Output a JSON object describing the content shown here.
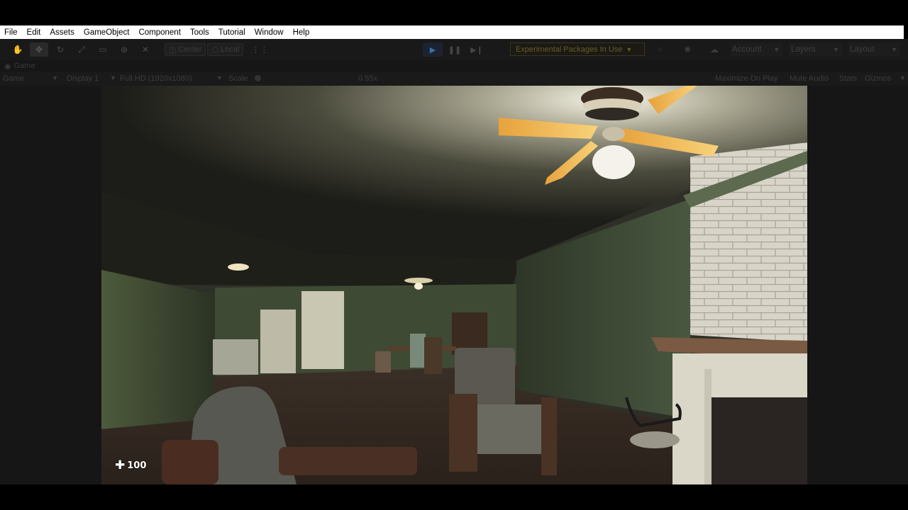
{
  "menubar": {
    "items": [
      "File",
      "Edit",
      "Assets",
      "GameObject",
      "Component",
      "Tools",
      "Tutorial",
      "Window",
      "Help"
    ]
  },
  "toolbar": {
    "pivot_label": "Center",
    "space_label": "Local",
    "experimental_label": "Experimental Packages In Use",
    "account_label": "Account",
    "layers_label": "Layers",
    "layout_label": "Layout",
    "play_state": "playing"
  },
  "game_view": {
    "tab_label": "Game",
    "mode_label": "Game",
    "display_label": "Display 1",
    "resolution_label": "Full HD (1920x1080)",
    "scale_label": "Scale",
    "scale_value": "0.55x",
    "maximize_label": "Maximize On Play",
    "mute_label": "Mute Audio",
    "stats_label": "Stats",
    "gizmos_label": "Gizmos"
  },
  "hud": {
    "health_icon": "plus-icon",
    "health_value": "100"
  },
  "colors": {
    "menubar_bg": "#ffffff",
    "editor_bg": "#191919",
    "play_accent": "#3b6fa8",
    "experimental_accent": "#6a5a28"
  }
}
